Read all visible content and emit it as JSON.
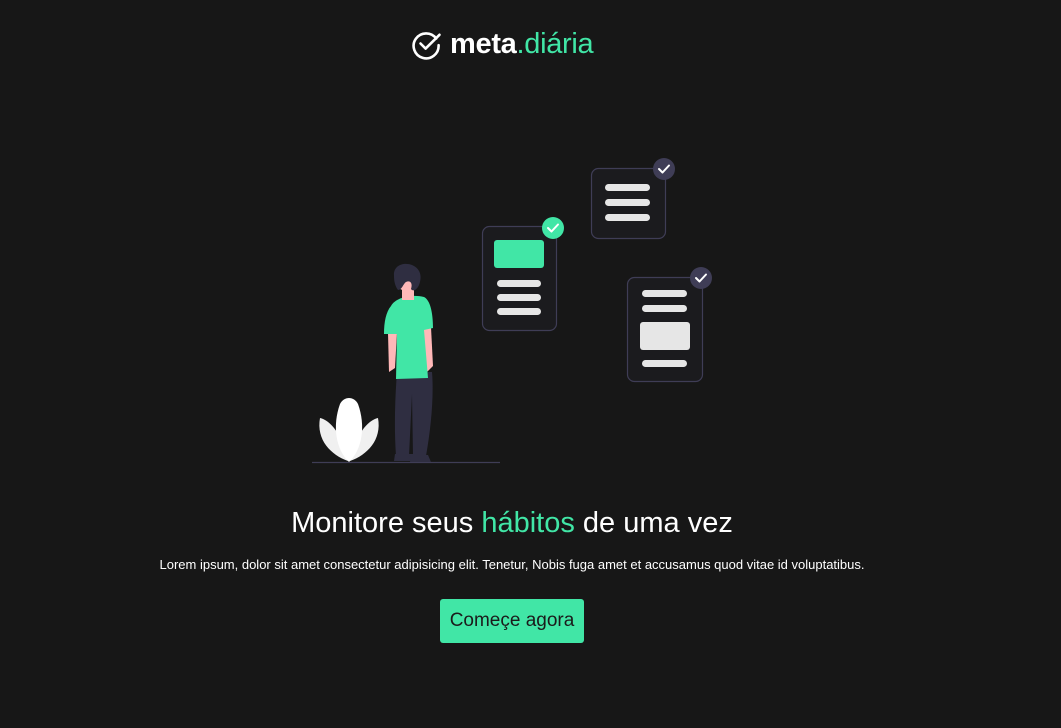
{
  "brand": {
    "name_strong": "meta",
    "name_accent": ".diária",
    "icon": "check-circle-icon"
  },
  "hero": {
    "headline_before": "Monitore seus ",
    "headline_accent": "hábitos",
    "headline_after": " de uma vez",
    "description": "Lorem ipsum, dolor sit amet consectetur adipisicing elit. Tenetur, Nobis fuga amet et accusamus quod vitae id voluptatibus.",
    "cta_label": "Começe agora"
  },
  "colors": {
    "background": "#171717",
    "accent": "#41e6a6",
    "text": "#ffffff",
    "card_border": "#3f3d56"
  },
  "illustration": {
    "cards": [
      {
        "icon": "check-icon",
        "checked_color": "#41e6a6"
      },
      {
        "icon": "check-icon",
        "checked_color": "#3f3d56"
      },
      {
        "icon": "check-icon",
        "checked_color": "#3f3d56"
      }
    ]
  }
}
